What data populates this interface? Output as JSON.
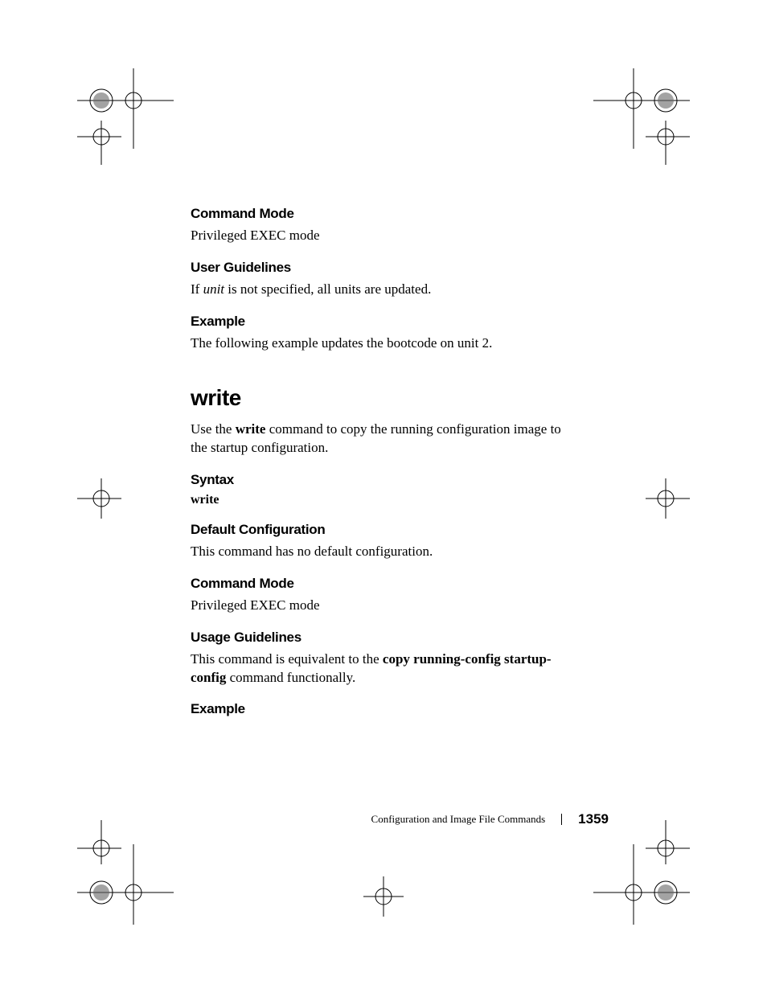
{
  "sections": {
    "commandMode1": {
      "heading": "Command Mode",
      "body": "Privileged EXEC mode"
    },
    "userGuidelines": {
      "heading": "User Guidelines",
      "pre": "If ",
      "italic": "unit",
      "post": " is not specified, all units are updated."
    },
    "example1": {
      "heading": "Example",
      "body": "The following example updates the bootcode on unit 2."
    },
    "mainCommand": "write",
    "mainDesc": {
      "pre": "Use the ",
      "bold": "write",
      "post": " command to copy the running configuration image to the startup configuration."
    },
    "syntax": {
      "heading": "Syntax",
      "body": "write"
    },
    "defaultConfig": {
      "heading": "Default Configuration",
      "body": "This command has no default configuration."
    },
    "commandMode2": {
      "heading": "Command Mode",
      "body": "Privileged EXEC mode"
    },
    "usageGuidelines": {
      "heading": "Usage Guidelines",
      "pre": "This command is equivalent to the ",
      "bold": "copy running-config startup-config",
      "post": " command functionally."
    },
    "example2": {
      "heading": "Example"
    }
  },
  "footer": {
    "title": "Configuration and Image File Commands",
    "page": "1359"
  }
}
